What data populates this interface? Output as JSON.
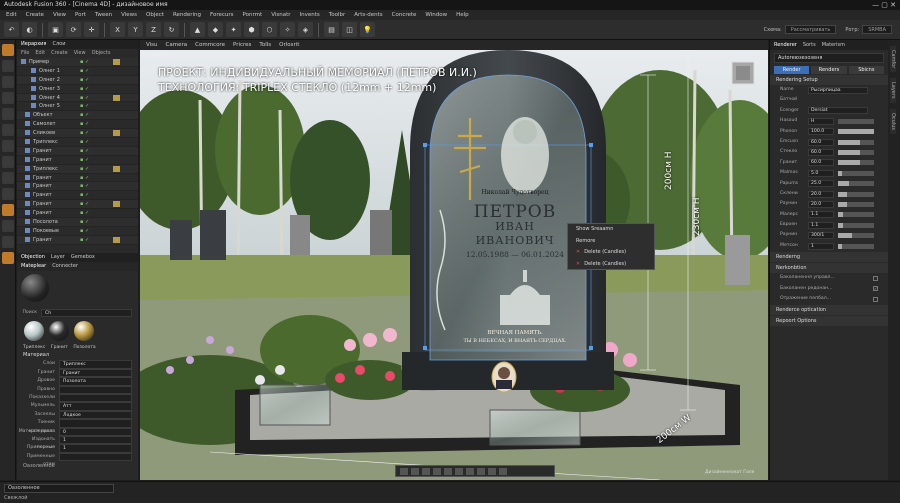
{
  "titlebar": {
    "title": "Autodesk Fusion 360 - [Cinema 4D] - дизайновое имя",
    "controls": "— ▢ ✕"
  },
  "menu": [
    "Edit",
    "Create",
    "View",
    "Port",
    "Tween",
    "Views",
    "Object",
    "Rendering",
    "Forecurs",
    "Ponrmt",
    "Visnatr",
    "Invents",
    "Toolbr",
    "Arts-dents",
    "Concrete",
    "Window",
    "Help"
  ],
  "toolbar": {
    "icons": [
      "↶",
      "◐",
      "▣",
      "⟳",
      "✛",
      "X",
      "Y",
      "Z",
      "↻",
      "▲",
      "◆",
      "✦",
      "⬢",
      "⬡",
      "✧",
      "◈",
      "▤",
      "◫",
      "💡"
    ],
    "layout_label": "Схема:",
    "layout_value": "Рассматривать",
    "render_label": "Ротр:",
    "render_value": "SRMBA"
  },
  "object_panel": {
    "tabs": [
      "Иерархия",
      "Слои"
    ],
    "menu": [
      "File",
      "Edit",
      "Create",
      "View",
      "Objects"
    ],
    "rows": [
      "Пример",
      "Олнег 1",
      "Олнег 2",
      "Олнег 3",
      "Олнег 4",
      "Олнег 5",
      "Объект",
      "Самолет",
      "Сликоев",
      "Триплекс",
      "Гранит",
      "Гранит",
      "Триплекс",
      "Гранит",
      "Гранит",
      "Гранит",
      "Гранит",
      "Гранит",
      "Посолота",
      "Покоевые",
      "Гранит"
    ]
  },
  "material_panel": {
    "tabs": [
      "Objection",
      "Layer",
      "Gemebox"
    ],
    "sub_tabs": [
      "Mateplear",
      "Connecter"
    ],
    "search_label": "Поиск",
    "search_value": "Сh",
    "swatches": [
      {
        "name": "Триплекс",
        "color": "#b8c8c8"
      },
      {
        "name": "Гранит",
        "color": "#2a2a2a"
      },
      {
        "name": "Позолота",
        "color": "#b8963c"
      }
    ],
    "section": "Материал",
    "props": [
      {
        "k": "Слои",
        "v": "Триплекс"
      },
      {
        "k": "Гранит",
        "v": "Гранит"
      },
      {
        "k": "Дровое",
        "v": "Позолота"
      },
      {
        "k": "Правно",
        "v": ""
      },
      {
        "k": "Показкели",
        "v": ""
      },
      {
        "k": "Мульмель",
        "v": "Атт"
      },
      {
        "k": "Засеелы",
        "v": "Лодкое"
      },
      {
        "k": "Тоеник материала",
        "v": ""
      },
      {
        "k": "Матерое проза",
        "v": "0"
      },
      {
        "k": "Издонать порные",
        "v": "1"
      },
      {
        "k": "Примерные",
        "v": "1"
      },
      {
        "k": "Применные отим",
        "v": ""
      }
    ],
    "footer": "Оазоленное"
  },
  "viewport": {
    "tabs": [
      "Visu",
      "Camera",
      "Commcore",
      "Pricres",
      "Tolls",
      "Orlosrit"
    ],
    "projection": "Perspective",
    "heading_line1": "ПРОЕКТ: ИНДИВИДУАЛЬНЫЙ МЕМОРИАЛ (ПЕТРОВ И.И.)",
    "heading_line2": "ТЕХНОЛОГИЯ: TRIPLEX СТЕКЛО (12mm + 12mm)",
    "saint_label": "Николай Чудотворец",
    "surname": "ПЕТРОВ",
    "name": "ИВАН",
    "patronymic": "ИВАНОВИЧ",
    "dates": "12.05.1988 — 06.01.2024",
    "epitaph1": "ВЕЧНАЯ ПАМЯТЬ.",
    "epitaph2": "ТЫ В НЕБЕСАХ, И ВНАЯТЬ СЕРДЦАХ.",
    "dim_inner_h": "200см Н",
    "dim_outer_h": "230см Н",
    "dim_width": "200см W",
    "watermark": "Дизайненеокат Голя"
  },
  "context_menu": {
    "items": [
      {
        "label": "Show Sreaamn",
        "x": false
      },
      {
        "label": "Remore",
        "x": false
      },
      {
        "label": "Delete (Candles)",
        "x": true
      },
      {
        "label": "Delete (Candles)",
        "x": true
      }
    ]
  },
  "render_panel": {
    "tabs": [
      "Renderer",
      "Sorts",
      "Materism"
    ],
    "name_field": "Autorеюзезозеня",
    "mode_buttons": [
      "Render",
      "Renders",
      "Sbicns"
    ],
    "section_setup": "Rendering Setup",
    "name_label": "Name",
    "name_value": "Рысирпицаа",
    "level_label": "Батчой",
    "preset_label": "Ecenger",
    "preset_value": "Dersiat",
    "rows": [
      {
        "k": "Hasoud",
        "v": "Н",
        "fill": 0
      },
      {
        "k": "Phonon",
        "v": "100.0",
        "fill": 1.0
      },
      {
        "k": "Emcusn",
        "v": "60.0",
        "fill": 0.6
      },
      {
        "k": "Стекло",
        "v": "60.0",
        "fill": 0.6
      },
      {
        "k": "Гранит",
        "v": "60.0",
        "fill": 0.6
      },
      {
        "k": "Malmas",
        "v": "5.0",
        "fill": 0.1
      },
      {
        "k": "Papums",
        "v": "25.0",
        "fill": 0.3
      },
      {
        "k": "Склени",
        "v": "20.0",
        "fill": 0.25
      },
      {
        "k": "Раунин",
        "v": "20.0",
        "fill": 0.25
      },
      {
        "k": "Малерс",
        "v": "1.1",
        "fill": 0.15
      },
      {
        "k": "Евроен",
        "v": "1.1",
        "fill": 0.15
      },
      {
        "k": "Раунин",
        "v": "300/1",
        "fill": 0.4
      },
      {
        "k": "Метсон",
        "v": "1",
        "fill": 0.1
      }
    ],
    "section_a": "Renderng",
    "section_b": "Nerkonbtion",
    "checks": [
      {
        "label": "Баколанення управл...",
        "checked": false
      },
      {
        "label": "Баколанен редонан...",
        "checked": true
      },
      {
        "label": "Отражение пепбал...",
        "checked": false
      }
    ],
    "section_c": "Renderce optication",
    "section_d": "Repoort Options"
  },
  "right_strip": [
    "Camfor",
    "Layers",
    "Oculus"
  ],
  "status": {
    "mode": "Оазоленное",
    "message": "Свежлой"
  }
}
